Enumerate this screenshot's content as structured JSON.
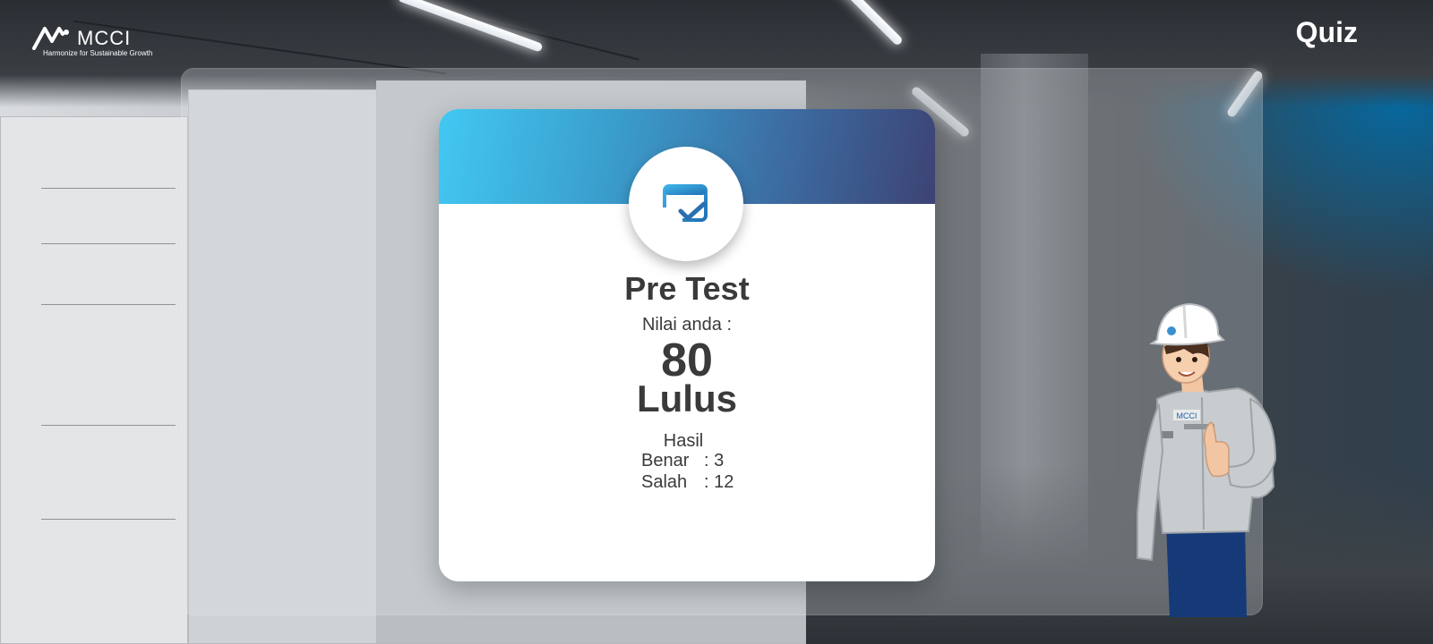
{
  "header": {
    "logo_name": "MCCI",
    "logo_tagline": "Harmonize for Sustainable Growth",
    "title": "Quiz"
  },
  "result": {
    "test_title": "Pre Test",
    "score_label": "Nilai anda :",
    "score": "80",
    "status": "Lulus",
    "summary_label": "Hasil",
    "rows": [
      {
        "label": "Benar",
        "value": ": 3"
      },
      {
        "label": "Salah",
        "value": ": 12"
      }
    ],
    "icon": "checklist-card-icon"
  },
  "character": {
    "badge_text": "MCCI"
  },
  "colors": {
    "header_gradient_start": "#42c8f2",
    "header_gradient_end": "#3d4374",
    "icon_color": "#2a86c8",
    "text": "#3a3a3a",
    "helmet": "#ffffff",
    "uniform": "#c9ccce",
    "pants": "#163a78"
  }
}
